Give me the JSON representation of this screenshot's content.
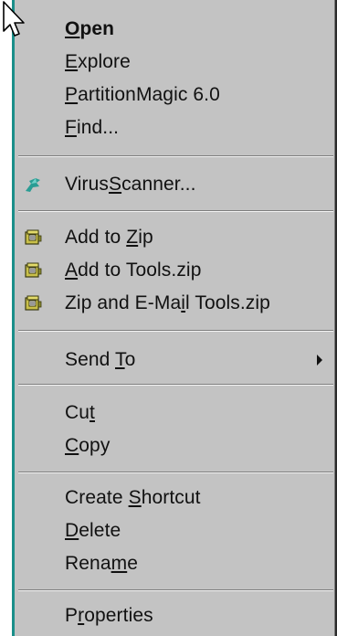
{
  "context_menu": {
    "items": [
      {
        "label_pre": "",
        "label_u": "O",
        "label_post": "pen",
        "bold": true,
        "icon": ""
      },
      {
        "label_pre": "",
        "label_u": "E",
        "label_post": "xplore",
        "icon": ""
      },
      {
        "label_pre": "",
        "label_u": "P",
        "label_post": "artitionMagic 6.0",
        "icon": ""
      },
      {
        "label_pre": "",
        "label_u": "F",
        "label_post": "ind...",
        "icon": ""
      },
      {
        "label_pre": "Virus",
        "label_u": "S",
        "label_post": "canner...",
        "icon": "virus-scanner-icon"
      },
      {
        "label_pre": "Add to ",
        "label_u": "Z",
        "label_post": "ip",
        "icon": "winzip-icon"
      },
      {
        "label_pre": "",
        "label_u": "A",
        "label_post": "dd to Tools.zip",
        "icon": "winzip-icon"
      },
      {
        "label_pre": "Zip and E-Ma",
        "label_u": "i",
        "label_post": "l Tools.zip",
        "icon": "winzip-icon"
      },
      {
        "label_pre": "Send ",
        "label_u": "T",
        "label_post": "o",
        "icon": "",
        "submenu": true
      },
      {
        "label_pre": "Cu",
        "label_u": "t",
        "label_post": "",
        "icon": ""
      },
      {
        "label_pre": "",
        "label_u": "C",
        "label_post": "opy",
        "icon": ""
      },
      {
        "label_pre": "Create ",
        "label_u": "S",
        "label_post": "hortcut",
        "icon": ""
      },
      {
        "label_pre": "",
        "label_u": "D",
        "label_post": "elete",
        "icon": ""
      },
      {
        "label_pre": "Rena",
        "label_u": "m",
        "label_post": "e",
        "icon": ""
      },
      {
        "label_pre": "P",
        "label_u": "r",
        "label_post": "operties",
        "icon": ""
      }
    ],
    "colors": {
      "menu_bg": "#c3c3c3",
      "accent_strip": "#1a8f8a",
      "text": "#111111"
    }
  }
}
